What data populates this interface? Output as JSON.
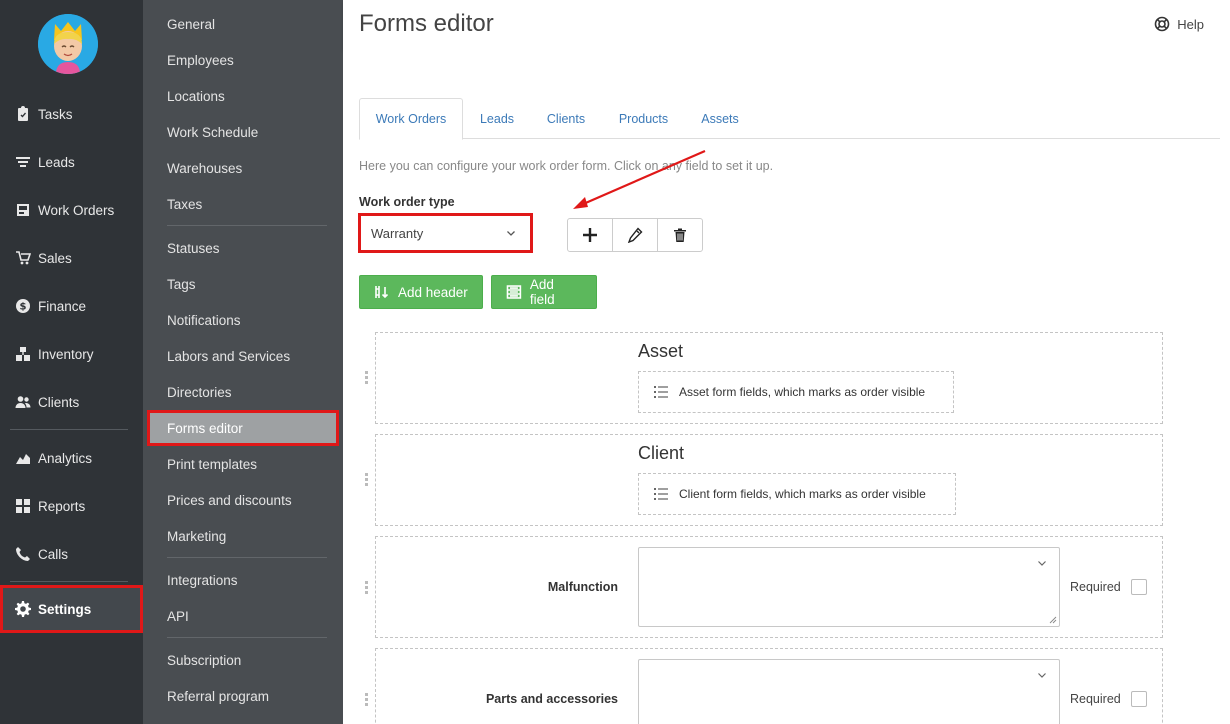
{
  "nav": {
    "items": [
      {
        "label": "Tasks",
        "icon": "clipboard-icon"
      },
      {
        "label": "Leads",
        "icon": "filter-icon"
      },
      {
        "label": "Work Orders",
        "icon": "work-orders-icon"
      },
      {
        "label": "Sales",
        "icon": "cart-icon"
      },
      {
        "label": "Finance",
        "icon": "dollar-icon"
      },
      {
        "label": "Inventory",
        "icon": "boxes-icon"
      },
      {
        "label": "Clients",
        "icon": "users-icon"
      },
      {
        "label": "Analytics",
        "icon": "chart-icon"
      },
      {
        "label": "Reports",
        "icon": "reports-icon"
      },
      {
        "label": "Calls",
        "icon": "phone-icon"
      },
      {
        "label": "Settings",
        "icon": "gear-icon"
      }
    ],
    "active": "Settings"
  },
  "submenu": {
    "items": [
      "General",
      "Employees",
      "Locations",
      "Work Schedule",
      "Warehouses",
      "Taxes",
      "Statuses",
      "Tags",
      "Notifications",
      "Labors and Services",
      "Directories",
      "Forms editor",
      "Print templates",
      "Prices and discounts",
      "Marketing",
      "Integrations",
      "API",
      "Subscription",
      "Referral program"
    ],
    "active": "Forms editor"
  },
  "header": {
    "title": "Forms editor",
    "help_label": "Help"
  },
  "tabs": [
    "Work Orders",
    "Leads",
    "Clients",
    "Products",
    "Assets"
  ],
  "active_tab": "Work Orders",
  "intro": "Here you can configure your work order form. Click on any field to set it up.",
  "work_order_type": {
    "label": "Work order type",
    "value": "Warranty"
  },
  "buttons": {
    "add_header": "Add header",
    "add_field": "Add field"
  },
  "sections": [
    {
      "title": "Asset",
      "note": "Asset form fields, which marks as order visible"
    },
    {
      "title": "Client",
      "note": "Client form fields, which marks as order visible"
    }
  ],
  "fields": [
    {
      "label": "Malfunction",
      "required_label": "Required",
      "required": false
    },
    {
      "label": "Parts and accessories",
      "required_label": "Required",
      "required": false
    }
  ],
  "colors": {
    "nav_bg": "#2f3337",
    "submenu_bg": "#494d51",
    "accent_link": "#3c7ab8",
    "green_button": "#5cb85c",
    "highlight_red": "#e01818"
  }
}
